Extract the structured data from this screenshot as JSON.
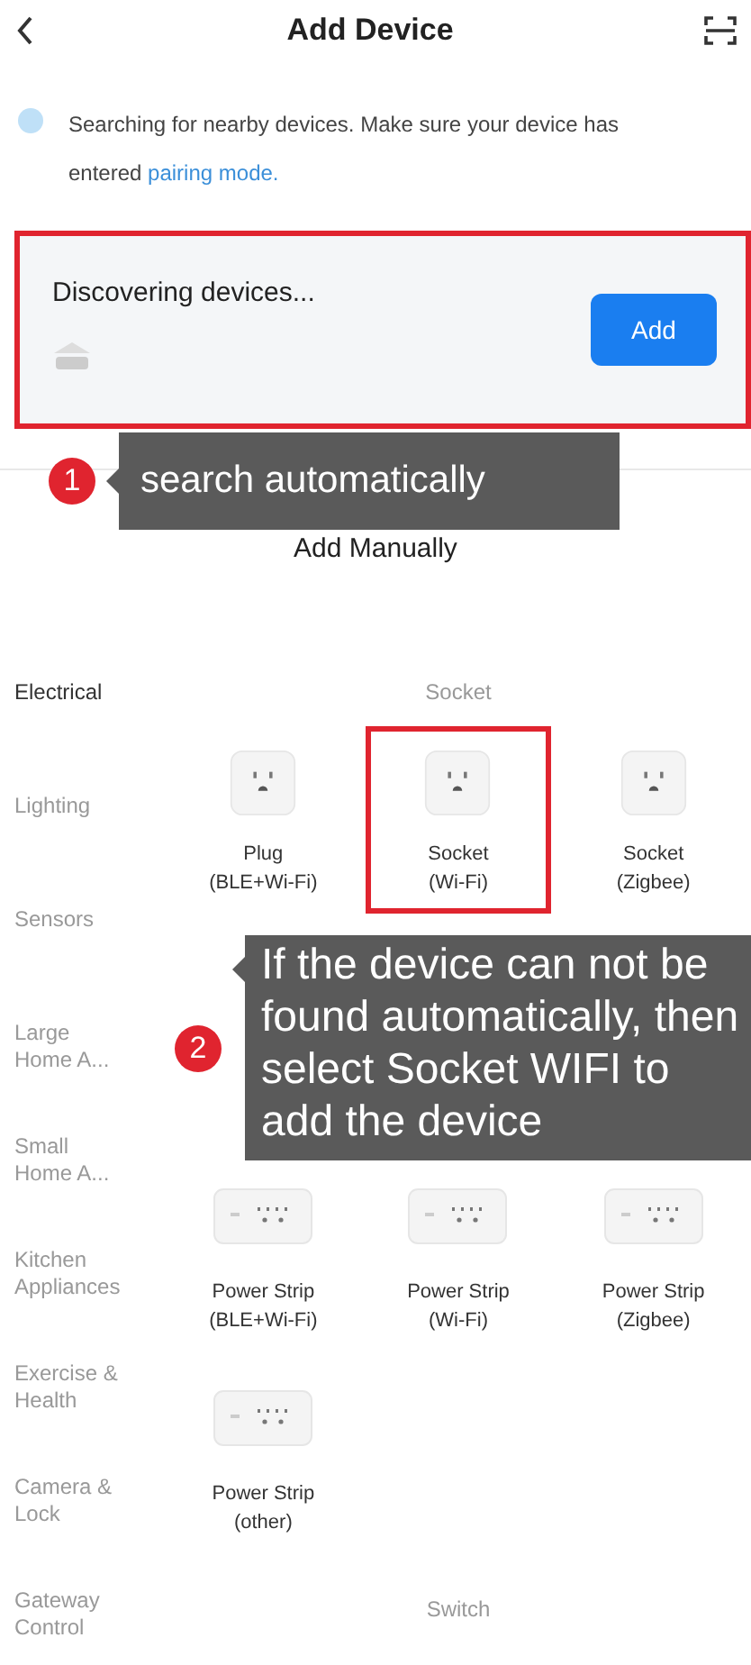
{
  "header": {
    "title": "Add Device"
  },
  "notice": {
    "text": "Searching for nearby devices. Make sure your device has entered",
    "link": "pairing mode."
  },
  "discovery": {
    "title": "Discovering devices...",
    "button": "Add",
    "highlighted": true
  },
  "callouts": [
    {
      "number": "1",
      "text": "search automatically"
    },
    {
      "number": "2",
      "text": "If the device can not be found automatically, then select Socket WIFI to add the device"
    }
  ],
  "manual_title": "Add Manually",
  "categories": [
    {
      "label": "Electrical",
      "selected": true
    },
    {
      "label": "Lighting",
      "selected": false
    },
    {
      "label": "Sensors",
      "selected": false
    },
    {
      "label": "Large Home A...",
      "selected": false
    },
    {
      "label": "Small Home A...",
      "selected": false
    },
    {
      "label": "Kitchen Appliances",
      "selected": false
    },
    {
      "label": "Exercise & Health",
      "selected": false
    },
    {
      "label": "Camera & Lock",
      "selected": false
    },
    {
      "label": "Gateway Control",
      "selected": false
    }
  ],
  "sections": [
    {
      "title": "Socket",
      "items": [
        {
          "kind": "socket",
          "name": "Plug",
          "variant": "(BLE+Wi-Fi)",
          "highlighted": false
        },
        {
          "kind": "socket",
          "name": "Socket",
          "variant": "(Wi-Fi)",
          "highlighted": true
        },
        {
          "kind": "socket",
          "name": "Socket",
          "variant": "(Zigbee)",
          "highlighted": false
        },
        {
          "kind": "callout"
        },
        {
          "kind": "strip",
          "name": "Power Strip",
          "variant": "(BLE+Wi-Fi)",
          "highlighted": false
        },
        {
          "kind": "strip",
          "name": "Power Strip",
          "variant": "(Wi-Fi)",
          "highlighted": false
        },
        {
          "kind": "strip",
          "name": "Power Strip",
          "variant": "(Zigbee)",
          "highlighted": false
        },
        {
          "kind": "strip",
          "name": "Power Strip",
          "variant": "(other)",
          "highlighted": false
        }
      ]
    },
    {
      "title": "Switch"
    }
  ]
}
